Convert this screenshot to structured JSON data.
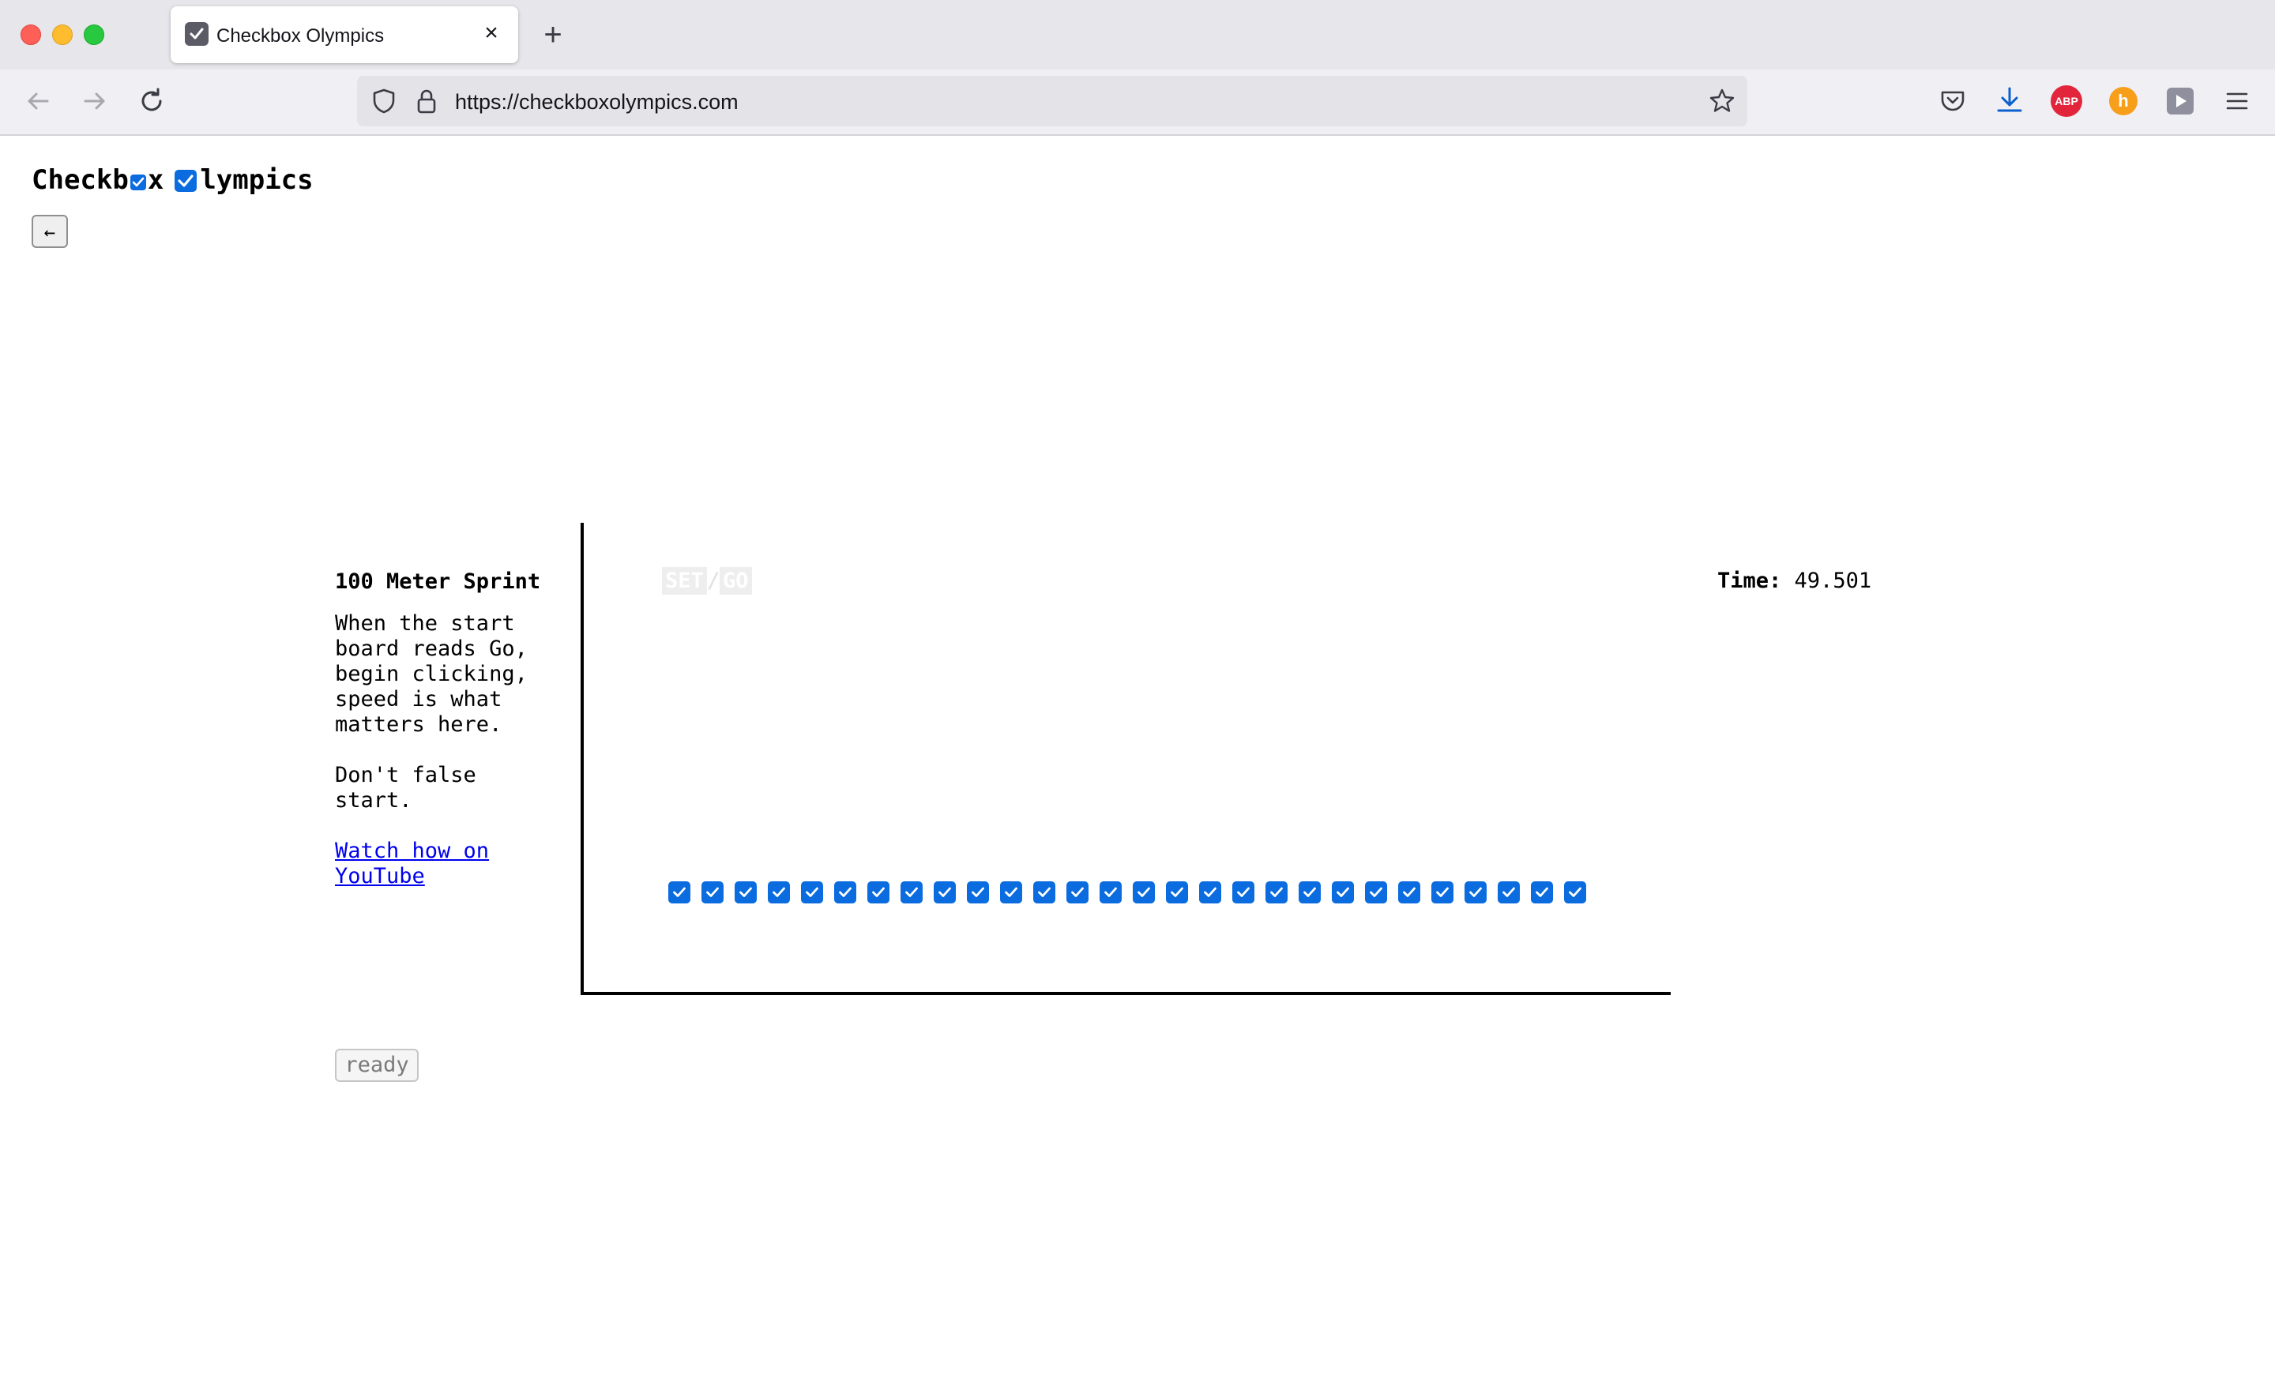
{
  "browser": {
    "tab_title": "Checkbox Olympics",
    "url": "https://checkboxolympics.com",
    "icons": [
      "back-arrow-icon",
      "forward-arrow-icon",
      "reload-icon",
      "shield-icon",
      "lock-icon",
      "star-icon",
      "pocket-icon",
      "download-icon",
      "adblock-plus-icon",
      "honey-icon",
      "play-extension-icon",
      "menu-icon"
    ],
    "adblock_text": "ABP",
    "honey_text": "h"
  },
  "site": {
    "title_part1": "Checkb",
    "title_part2": "x",
    "title_part3": "lympics",
    "back_label": "←"
  },
  "event": {
    "name": "100 Meter Sprint",
    "description": "When the start\nboard reads Go,\nbegin clicking,\nspeed is what\nmatters here.",
    "warning": "Don't false\nstart.",
    "watch_link": "Watch how on YouTube",
    "ready_label": "ready"
  },
  "startboard": {
    "set_label": "SET",
    "separator": "/",
    "go_label": "GO"
  },
  "timer": {
    "label": "Time:",
    "value": "49.501"
  },
  "lane": {
    "checkbox_count": 28,
    "checked": true,
    "accent_color": "#0a6cdf"
  }
}
